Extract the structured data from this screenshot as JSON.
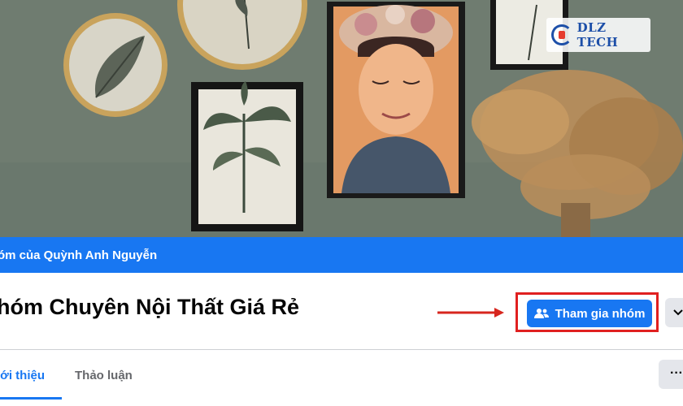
{
  "group": {
    "owner_line": "óm của Quỳnh Anh Nguyễn",
    "title": "hóm Chuyên Nội Thất Giá Rẻ",
    "join_label": "Tham gia nhóm",
    "more_glyph": "⌄",
    "options_glyph": "···"
  },
  "tabs": [
    {
      "label": "iới thiệu",
      "active": true
    },
    {
      "label": "Thảo luận",
      "active": false
    }
  ],
  "watermark": {
    "text": "DLZ TECH"
  },
  "icons": {
    "join": "people-icon",
    "more": "chevron-down-icon",
    "options": "more-horizontal-icon",
    "arrow": "arrow-right-icon"
  },
  "colors": {
    "facebook_blue": "#1877f2",
    "highlight_red": "#e02020",
    "wall": "#6f7c70"
  }
}
